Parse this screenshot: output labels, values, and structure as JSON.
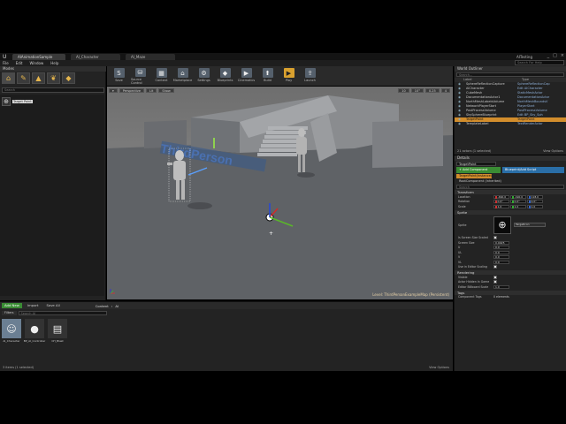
{
  "window": {
    "tabs": [
      "AIAnimationSample",
      "AI_Character",
      "AI_Maze"
    ],
    "project": "AITesting",
    "controls": [
      "_",
      "□",
      "×"
    ]
  },
  "menu": {
    "items": [
      "File",
      "Edit",
      "Window",
      "Help"
    ],
    "search_placeholder": "Search For Help"
  },
  "modes": {
    "title": "Modes",
    "search_placeholder": "Search",
    "selected_item_label": "Target Point"
  },
  "toolbar": {
    "items": [
      {
        "label": "Save",
        "icon": "S"
      },
      {
        "label": "Source Control",
        "icon": "⛁"
      },
      {
        "label": "Content",
        "icon": "▦"
      },
      {
        "label": "Marketplace",
        "icon": "⌂"
      },
      {
        "label": "Settings",
        "icon": "⚙"
      },
      {
        "label": "Blueprints",
        "icon": "◆"
      },
      {
        "label": "Cinematics",
        "icon": "▶"
      },
      {
        "label": "Build",
        "icon": "⬆"
      },
      {
        "label": "Play",
        "icon": "▶"
      },
      {
        "label": "Launch",
        "icon": "⇪"
      }
    ]
  },
  "viewport": {
    "buttons": [
      "▾",
      "Perspective",
      "Lit",
      "Show"
    ],
    "right_buttons": [
      "10",
      "10°",
      "0.25",
      "4"
    ],
    "level_label": "Level: ThirdPersonExampleMap (Persistent)",
    "floor_text": "ThirdPerson"
  },
  "world_outliner": {
    "title": "World Outliner",
    "search_placeholder": "Search...",
    "columns": [
      "Label",
      "Type"
    ],
    "rows": [
      {
        "label": "SphereReflectionCapture",
        "type": "SphereReflectionCap"
      },
      {
        "label": "AICharacter",
        "type": "Edit AICharacter"
      },
      {
        "label": "CubeMesh",
        "type": "StaticMeshActor"
      },
      {
        "label": "DocumentationActor1",
        "type": "DocumentationActor"
      },
      {
        "label": "NorthMeshLabelsVolume",
        "type": "NorthMeshBoundsV"
      },
      {
        "label": "NetworkPlayerStart",
        "type": "PlayerStart"
      },
      {
        "label": "PostProcessVolume",
        "type": "PostProcessVolume"
      },
      {
        "label": "SkySphereBlueprint",
        "type": "Edit BP_Sky_Sph"
      },
      {
        "label": "TargetPoint",
        "type": "TargetPoint",
        "selected": true
      },
      {
        "label": "TemplateLabel",
        "type": "TextRenderActor"
      }
    ],
    "footer_count": "21 actors (1 selected)",
    "footer_options": "View Options"
  },
  "details": {
    "title": "Details",
    "actor_name": "TargetPoint",
    "add_component": "+ Add Component",
    "blueprint_script": "Blueprint/Add Script",
    "self_row": "TargetPoint(Instance)",
    "root_row": "RootComponent (Inherited)",
    "search_placeholder": "Search",
    "transform": {
      "title": "Transform",
      "location": {
        "label": "Location",
        "values": [
          "-490.0",
          "-190.0",
          "118.0"
        ]
      },
      "rotation": {
        "label": "Rotation",
        "values": [
          "0.0°",
          "0.0°",
          "0.0°"
        ]
      },
      "scale": {
        "label": "Scale",
        "values": [
          "1.0",
          "1.0",
          "1.0"
        ]
      }
    },
    "sprite": {
      "title": "Sprite",
      "sprite_label": "Sprite",
      "sprite_value": "TargetIcon",
      "props": [
        {
          "label": "Is Screen Size Scaled",
          "kind": "check"
        },
        {
          "label": "Screen Size",
          "kind": "num",
          "value": "0.0025"
        },
        {
          "label": "U",
          "kind": "num",
          "value": "0.0"
        },
        {
          "label": "UL",
          "kind": "num",
          "value": "0.0"
        },
        {
          "label": "V",
          "kind": "num",
          "value": "0.0"
        },
        {
          "label": "VL",
          "kind": "num",
          "value": "0.0"
        },
        {
          "label": "Use in Editor Scaling",
          "kind": "check"
        }
      ]
    },
    "rendering": {
      "title": "Rendering",
      "props": [
        {
          "label": "Visible",
          "kind": "check"
        },
        {
          "label": "Actor Hidden In Game",
          "kind": "check"
        },
        {
          "label": "Editor Billboard Scale",
          "kind": "num",
          "value": "1.0"
        }
      ]
    },
    "tags": {
      "title": "Tags",
      "label": "Component Tags",
      "value": "0 elements"
    }
  },
  "content_browser": {
    "add_new": "Add New",
    "import": "Import",
    "save_all": "Save All",
    "breadcrumb": [
      "Content",
      "AI"
    ],
    "filters": "Filters",
    "search_placeholder": "Search AI",
    "assets": [
      {
        "label": "AI_Character",
        "icon": "☺",
        "selected": true
      },
      {
        "label": "BP_AI_Controller",
        "icon": "●"
      },
      {
        "label": "CH_Blast",
        "icon": "▤"
      }
    ],
    "status": "3 items (1 selected)",
    "view_options": "View Options"
  }
}
